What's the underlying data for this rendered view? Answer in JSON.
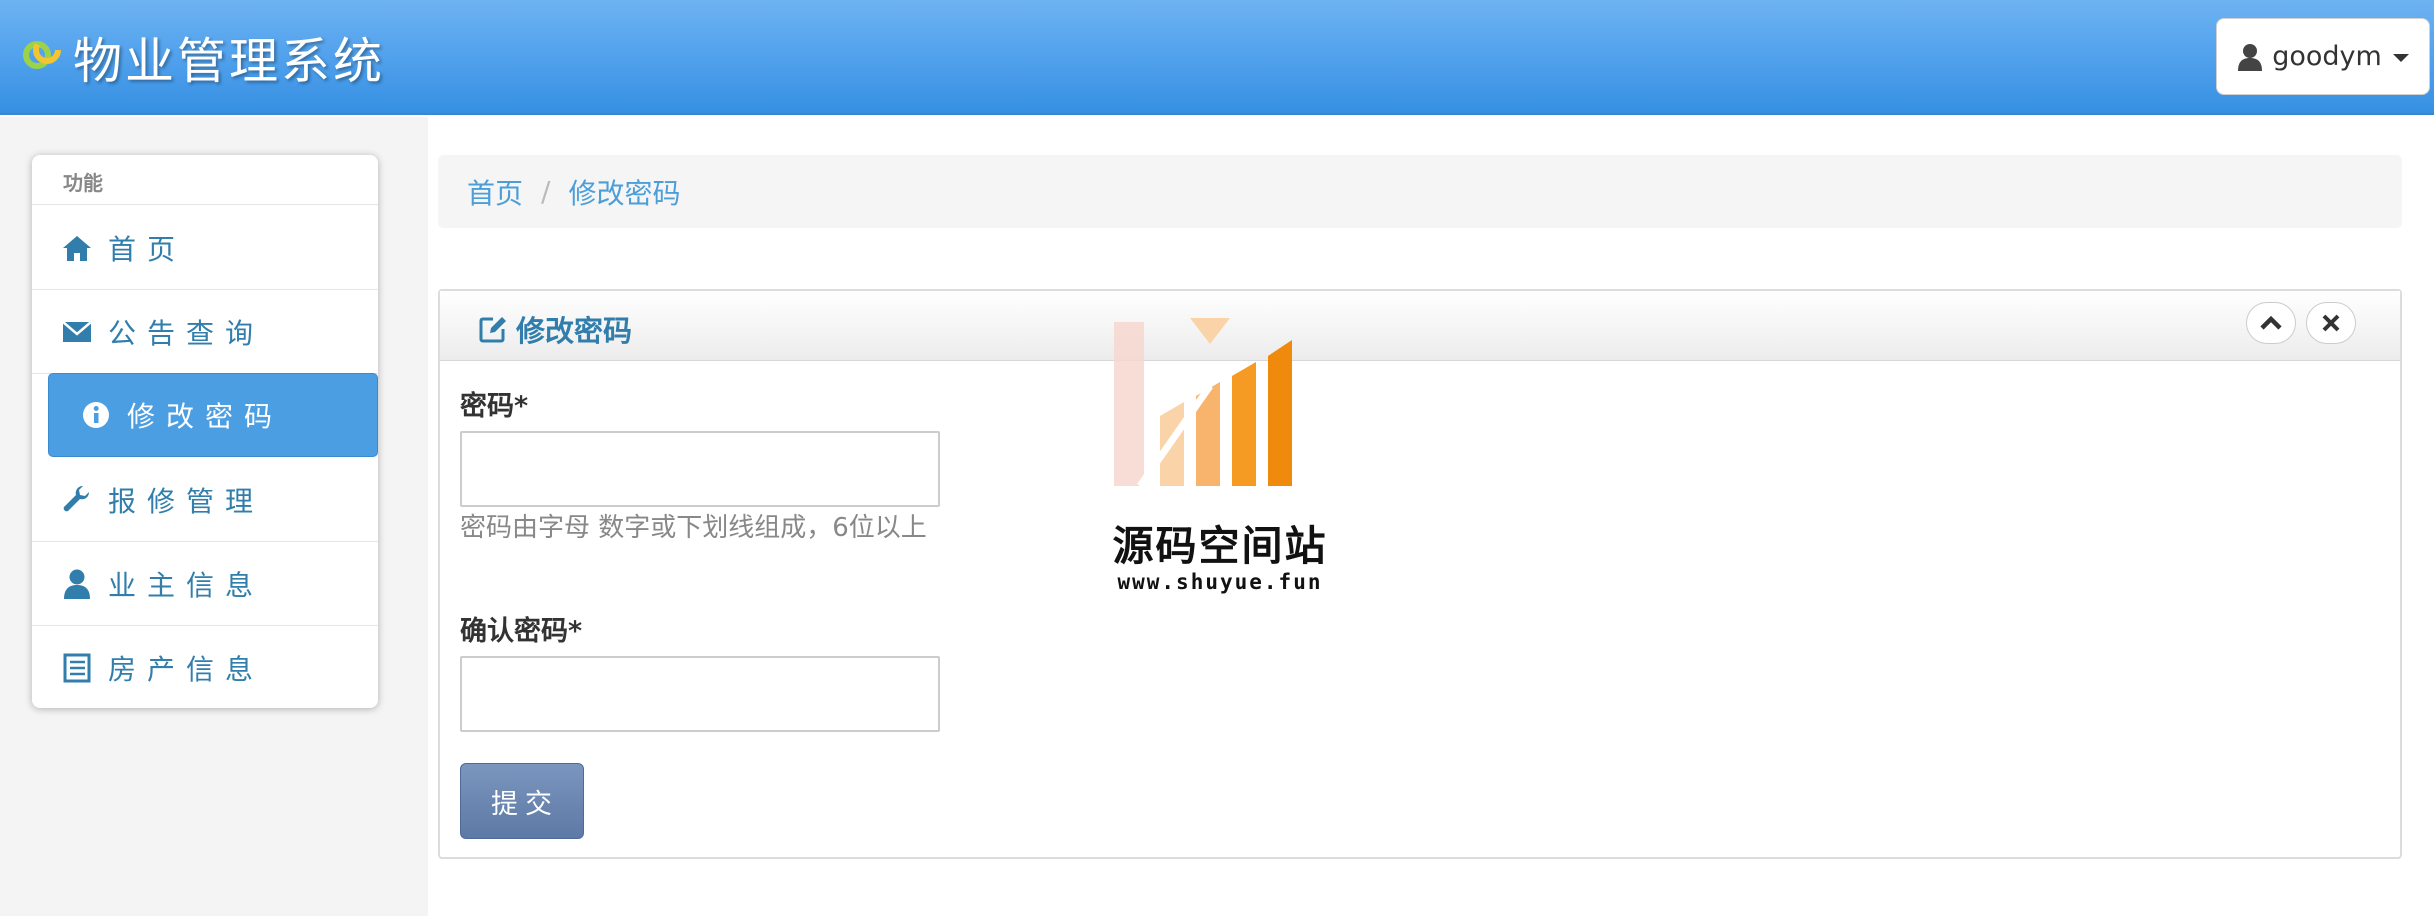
{
  "app": {
    "title": "物业管理系统",
    "user_name": "goodym"
  },
  "sidebar": {
    "header": "功能",
    "items": [
      {
        "label": "首页",
        "icon": "home-icon"
      },
      {
        "label": "公告查询",
        "icon": "envelope-icon"
      },
      {
        "label": "修改密码",
        "icon": "info-icon",
        "active": true
      },
      {
        "label": "报修管理",
        "icon": "wrench-icon"
      },
      {
        "label": "业主信息",
        "icon": "user-icon"
      },
      {
        "label": "房产信息",
        "icon": "list-icon"
      }
    ]
  },
  "breadcrumb": {
    "items": [
      "首页",
      "修改密码"
    ],
    "separator": "/"
  },
  "panel": {
    "title": "修改密码",
    "password_label": "密码*",
    "password_value": "",
    "password_help": "密码由字母 数字或下划线组成，6位以上",
    "confirm_label": "确认密码*",
    "confirm_value": "",
    "submit_label": "提交"
  },
  "watermark": {
    "text": "源码空间站",
    "url": "www.shuyue.fun"
  },
  "colors": {
    "navbar": "#54a3ee",
    "link": "#317eac",
    "active_item": "#4c9ee3",
    "submit_button": "#6a86b1",
    "watermark_orange": "#f59a23"
  }
}
